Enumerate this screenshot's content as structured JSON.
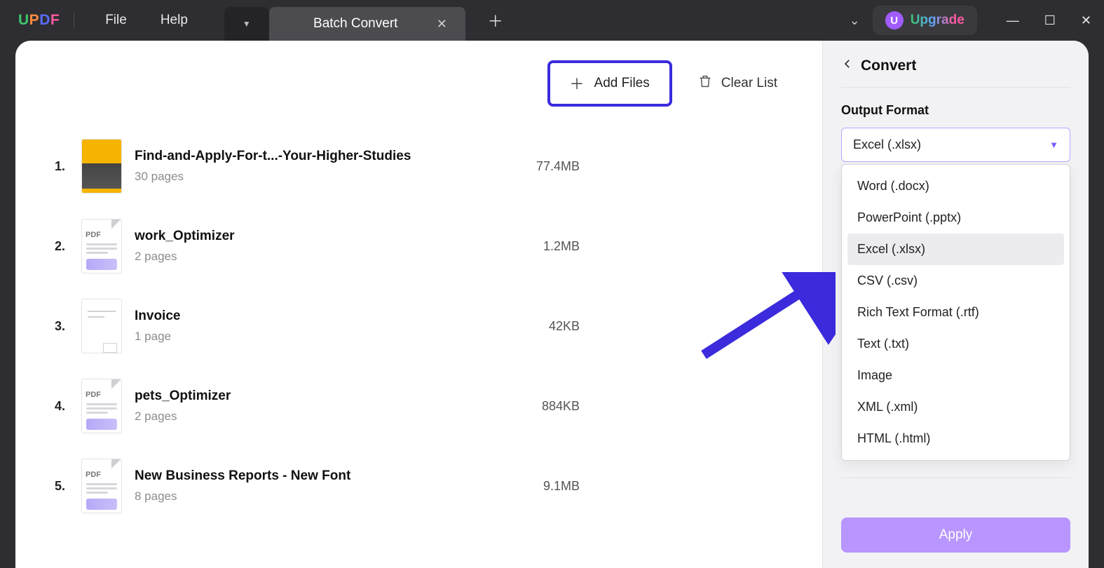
{
  "app": {
    "logo": "UPDF"
  },
  "menu": {
    "file": "File",
    "help": "Help"
  },
  "tabs": {
    "active_label": "Batch Convert"
  },
  "titlebar": {
    "upgrade_label": "Upgrade",
    "upgrade_badge": "U"
  },
  "actions": {
    "add_files": "Add Files",
    "clear_list": "Clear List"
  },
  "files": [
    {
      "num": "1.",
      "name": "Find-and-Apply-For-t...-Your-Higher-Studies",
      "pages": "30 pages",
      "size": "77.4MB",
      "thumb": "yellow"
    },
    {
      "num": "2.",
      "name": "work_Optimizer",
      "pages": "2 pages",
      "size": "1.2MB",
      "thumb": "pdf"
    },
    {
      "num": "3.",
      "name": "Invoice",
      "pages": "1 page",
      "size": "42KB",
      "thumb": "invoice"
    },
    {
      "num": "4.",
      "name": "pets_Optimizer",
      "pages": "2 pages",
      "size": "884KB",
      "thumb": "pdf"
    },
    {
      "num": "5.",
      "name": "New Business Reports - New Font",
      "pages": "8 pages",
      "size": "9.1MB",
      "thumb": "pdf"
    }
  ],
  "sidebar": {
    "title": "Convert",
    "output_format_label": "Output Format",
    "selected": "Excel (.xlsx)",
    "options": [
      {
        "label": "Word (.docx)",
        "highlight": false
      },
      {
        "label": "PowerPoint (.pptx)",
        "highlight": false
      },
      {
        "label": "Excel (.xlsx)",
        "highlight": true
      },
      {
        "label": "CSV (.csv)",
        "highlight": false
      },
      {
        "label": "Rich Text Format (.rtf)",
        "highlight": false
      },
      {
        "label": "Text (.txt)",
        "highlight": false
      },
      {
        "label": "Image",
        "highlight": false
      },
      {
        "label": "XML (.xml)",
        "highlight": false
      },
      {
        "label": "HTML (.html)",
        "highlight": false
      }
    ],
    "apply": "Apply"
  }
}
